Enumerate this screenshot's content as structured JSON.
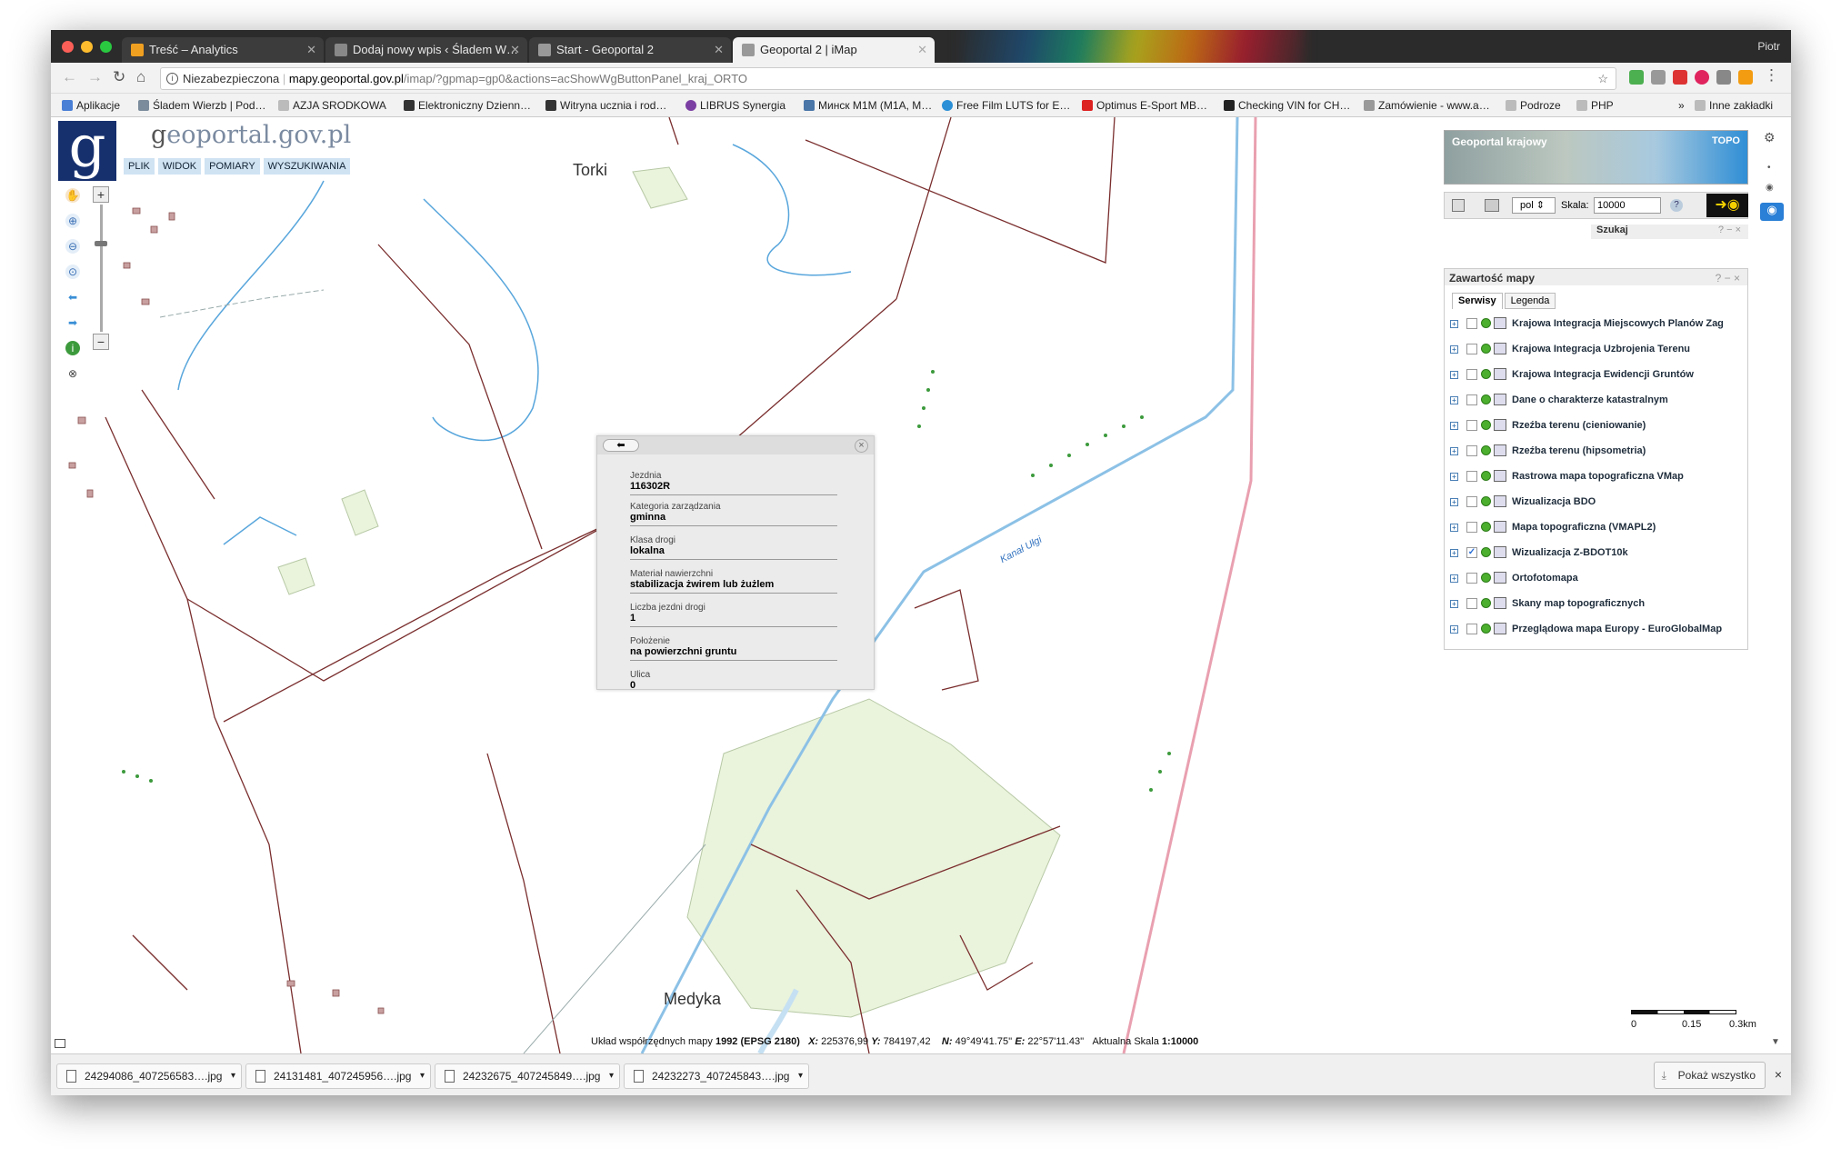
{
  "browser": {
    "user": "Piotr",
    "tabs": [
      {
        "title": "Treść – Analytics",
        "color": "#f0a020",
        "active": false
      },
      {
        "title": "Dodaj nowy wpis ‹ Śladem W…",
        "color": "#888888",
        "active": false
      },
      {
        "title": "Start - Geoportal 2",
        "color": "#999999",
        "active": false
      },
      {
        "title": "Geoportal 2 | iMap",
        "color": "#999999",
        "active": true
      }
    ],
    "security": "Niezabezpieczona",
    "url_host": "mapy.geoportal.gov.pl",
    "url_path": "/imap/?gpmap=gp0&actions=acShowWgButtonPanel_kraj_ORTO",
    "bookmarks": [
      "Aplikacje",
      "Śladem Wierzb | Pod…",
      "AZJA SRODKOWA",
      "Elektroniczny Dzienn…",
      "Witryna ucznia i rod…",
      "LIBRUS Synergia",
      "Минск М1М (М1А, М…",
      "Free Film LUTS for E…",
      "Optimus E-Sport MB…",
      "Checking VIN for CH…",
      "Zamówienie - www.a…",
      "Podroze",
      "PHP"
    ],
    "more_bookmarks": "»",
    "other_bookmarks": "Inne zakładki"
  },
  "geoportal": {
    "logo_letter": "g",
    "site_prefix": "g",
    "site_name": "eoportal.gov.pl",
    "menu": [
      "PLIK",
      "WIDOK",
      "POMIARY",
      "WYSZUKIWANIA"
    ],
    "zoom_in": "+",
    "zoom_out": "−"
  },
  "map_labels": {
    "torki": "Torki",
    "medyka": "Medyka",
    "kanal": "Kanał Ułgi"
  },
  "popup": {
    "back": "⬅",
    "close": "×",
    "fields": [
      {
        "label": "Jezdnia",
        "value": "116302R"
      },
      {
        "label": "Kategoria zarządzania",
        "value": "gminna"
      },
      {
        "label": "Klasa drogi",
        "value": "lokalna"
      },
      {
        "label": "Materiał nawierzchni",
        "value": "stabilizacja żwirem lub żużlem"
      },
      {
        "label": "Liczba jezdni drogi",
        "value": "1"
      },
      {
        "label": "Położenie",
        "value": "na powierzchni gruntu"
      },
      {
        "label": "Ulica",
        "value": "0"
      }
    ]
  },
  "right_panel": {
    "krajowy_title": "Geoportal krajowy",
    "krajowy_mode": "TOPO",
    "lang": "pol",
    "scale_label": "Skala:",
    "scale_value": "10000",
    "search_title": "Szukaj",
    "layers_title": "Zawartość mapy",
    "tab_services": "Serwisy",
    "tab_legend": "Legenda",
    "layers": [
      {
        "name": "Krajowa Integracja Miejscowych Planów Zag",
        "checked": false
      },
      {
        "name": "Krajowa Integracja Uzbrojenia Terenu",
        "checked": false
      },
      {
        "name": "Krajowa Integracja Ewidencji Gruntów",
        "checked": false
      },
      {
        "name": "Dane o charakterze katastralnym",
        "checked": false
      },
      {
        "name": "Rzeźba terenu (cieniowanie)",
        "checked": false
      },
      {
        "name": "Rzeźba terenu (hipsometria)",
        "checked": false
      },
      {
        "name": "Rastrowa mapa topograficzna VMap",
        "checked": false
      },
      {
        "name": "Wizualizacja BDO",
        "checked": false
      },
      {
        "name": "Mapa topograficzna (VMAPL2)",
        "checked": false
      },
      {
        "name": "Wizualizacja Z-BDOT10k",
        "checked": true
      },
      {
        "name": "Ortofotomapa",
        "checked": false
      },
      {
        "name": "Skany map topograficznych",
        "checked": false
      },
      {
        "name": "Przeglądowa mapa Europy - EuroGlobalMap",
        "checked": false
      }
    ]
  },
  "status": {
    "coord_system_label": "Układ współrzędnych mapy",
    "coord_system": "1992 (EPSG 2180)",
    "x_label": "X:",
    "x": "225376,99",
    "y_label": "Y:",
    "y": "784197,42",
    "n_label": "N:",
    "n": "49°49'41.75''",
    "e_label": "E:",
    "e": "22°57'11.43''",
    "scale_label": "Aktualna Skala",
    "scale": "1:10000",
    "scalebar": [
      "0",
      "0.15",
      "0.3km"
    ]
  },
  "downloads": {
    "files": [
      "24294086_407256583….jpg",
      "24131481_407245956….jpg",
      "24232675_407245849….jpg",
      "24232273_407245843….jpg"
    ],
    "show_all": "Pokaż wszystko",
    "close": "×"
  }
}
